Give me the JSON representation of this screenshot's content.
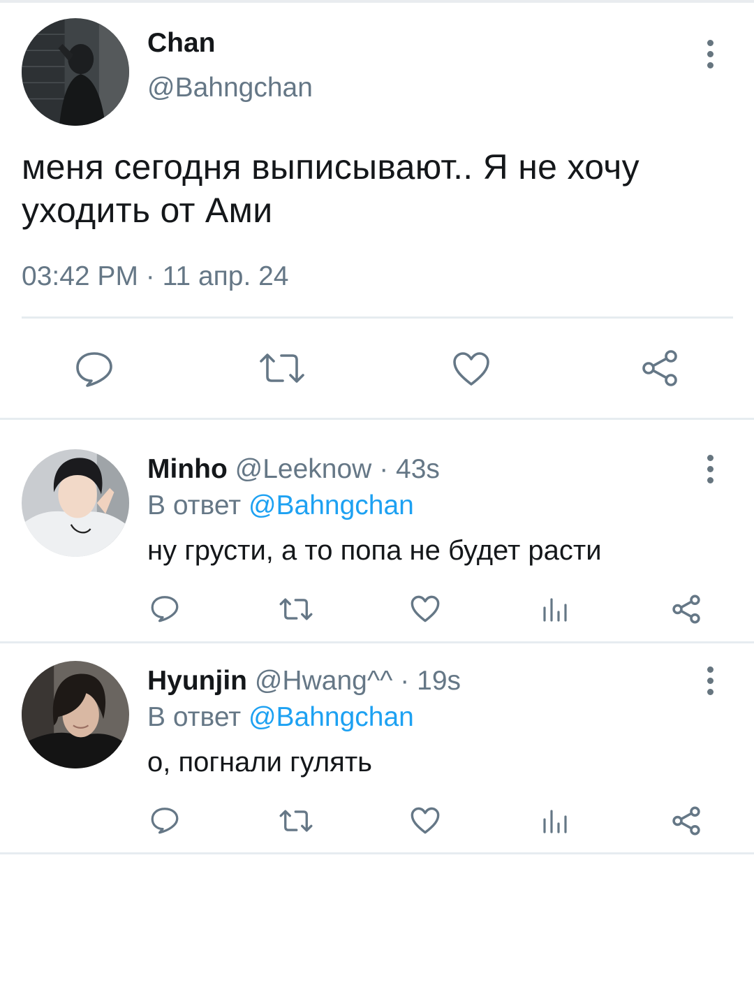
{
  "main_tweet": {
    "author_name": "Chan",
    "author_handle": "@Bahngchan",
    "text": "меня сегодня выписывают.. Я не хочу уходить от Ами",
    "time": "03:42 PM",
    "separator": "·",
    "date": "11 апр. 24",
    "actions": [
      "reply-icon",
      "retweet-icon",
      "like-icon",
      "share-icon"
    ]
  },
  "replies": [
    {
      "author_name": "Minho",
      "author_handle": "@Leeknow",
      "separator": "·",
      "time": "43s",
      "reply_prefix": "В ответ",
      "reply_to": "@Bahngchan",
      "text": "ну грусти, а то попа не будет расти"
    },
    {
      "author_name": "Hyunjin",
      "author_handle": "@Hwang^^",
      "separator": "·",
      "time": "19s",
      "reply_prefix": "В ответ",
      "reply_to": "@Bahngchan",
      "text": "о, погнали гулять"
    }
  ],
  "colors": {
    "icon": "#657786",
    "link": "#1da1f2",
    "muted": "#657786",
    "text": "#14171a",
    "divider": "#e6ecf0"
  }
}
